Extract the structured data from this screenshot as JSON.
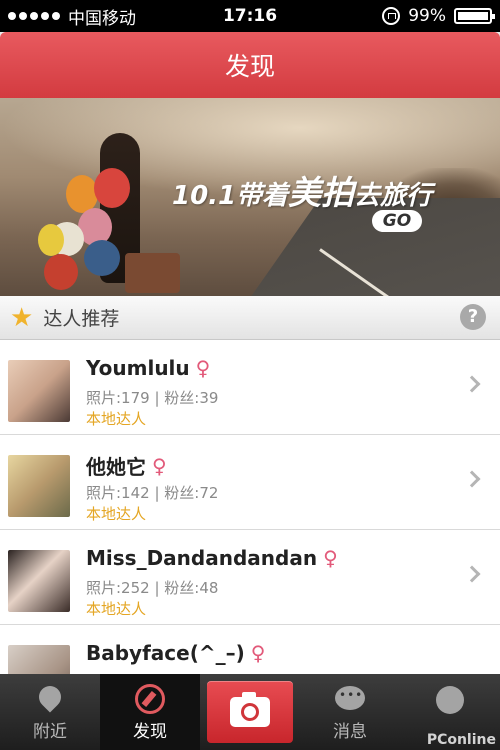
{
  "statusbar": {
    "carrier": "中国移动",
    "time": "17:16",
    "battery": "99%"
  },
  "navbar": {
    "title": "发现"
  },
  "banner": {
    "title_part1": "10.1带着",
    "title_big": "美拍",
    "title_part2": "去旅行",
    "go_label": "GO"
  },
  "section": {
    "title": "达人推荐",
    "help": "?"
  },
  "users": [
    {
      "name": "Youmlulu",
      "stats": "照片:179 | 粉丝:39",
      "tag": "本地达人"
    },
    {
      "name": "他她它",
      "stats": "照片:142 | 粉丝:72",
      "tag": "本地达人"
    },
    {
      "name": "Miss_Dandandandan",
      "stats": "照片:252 | 粉丝:48",
      "tag": "本地达人"
    },
    {
      "name": "Babyface(^_–)",
      "stats": "",
      "tag": ""
    }
  ],
  "tabs": [
    {
      "label": "附近",
      "icon": "location-pin-icon"
    },
    {
      "label": "发现",
      "icon": "compass-icon"
    },
    {
      "label": "",
      "icon": "camera-icon"
    },
    {
      "label": "消息",
      "icon": "chat-bubble-icon"
    },
    {
      "label": "",
      "icon": "profile-icon"
    }
  ],
  "watermark": {
    "brand": "PConline"
  },
  "colors": {
    "brand_red": "#d33b40",
    "tag_orange": "#e4a624",
    "female_pink": "#e25a7a"
  }
}
